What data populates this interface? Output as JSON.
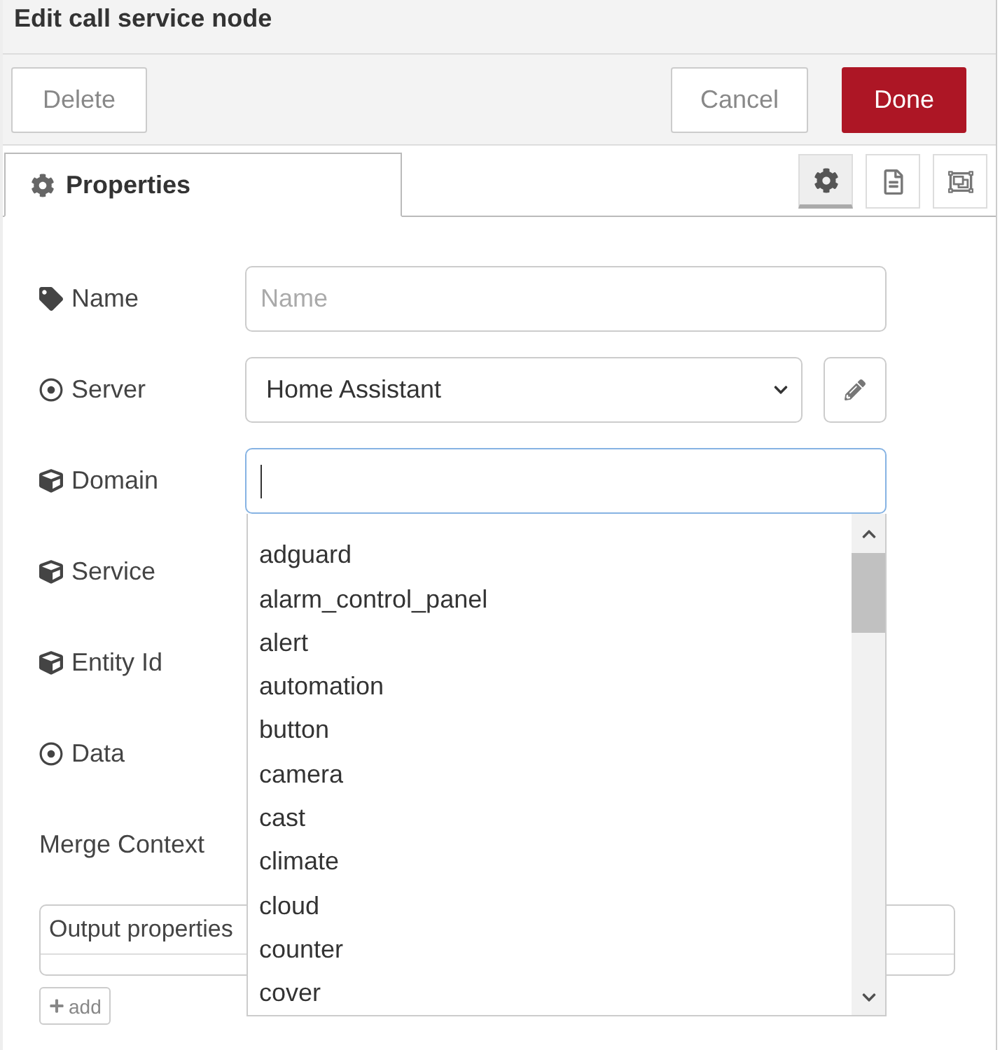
{
  "window": {
    "title": "Edit call service node"
  },
  "actions": {
    "left": [
      {
        "label": "Delete",
        "kind": "default"
      }
    ],
    "right": [
      {
        "label": "Cancel",
        "kind": "default"
      },
      {
        "label": "Done",
        "kind": "primary"
      }
    ]
  },
  "tabs": [
    {
      "label": "Properties",
      "selected": true
    }
  ],
  "tool_tabs": [
    {
      "selected": true
    },
    {
      "selected": false
    },
    {
      "selected": false
    }
  ],
  "fields": [
    {
      "label": "Name",
      "kind": "input",
      "placeholder": "Name",
      "focused": false
    },
    {
      "label": "Server",
      "kind": "select",
      "value": "Home Assistant"
    },
    {
      "label": "Domain",
      "kind": "input",
      "focused": true,
      "options": [
        "adguard",
        "alarm_control_panel",
        "alert",
        "automation",
        "button",
        "camera",
        "cast",
        "climate",
        "cloud",
        "counter",
        "cover"
      ]
    },
    {
      "label": "Service",
      "kind": "covered"
    },
    {
      "label": "Entity Id",
      "kind": "covered"
    },
    {
      "label": "Data",
      "kind": "covered"
    },
    {
      "label": "Merge Context",
      "kind": "covered"
    }
  ],
  "output_properties": {
    "title": "Output properties",
    "add_label": "add"
  }
}
